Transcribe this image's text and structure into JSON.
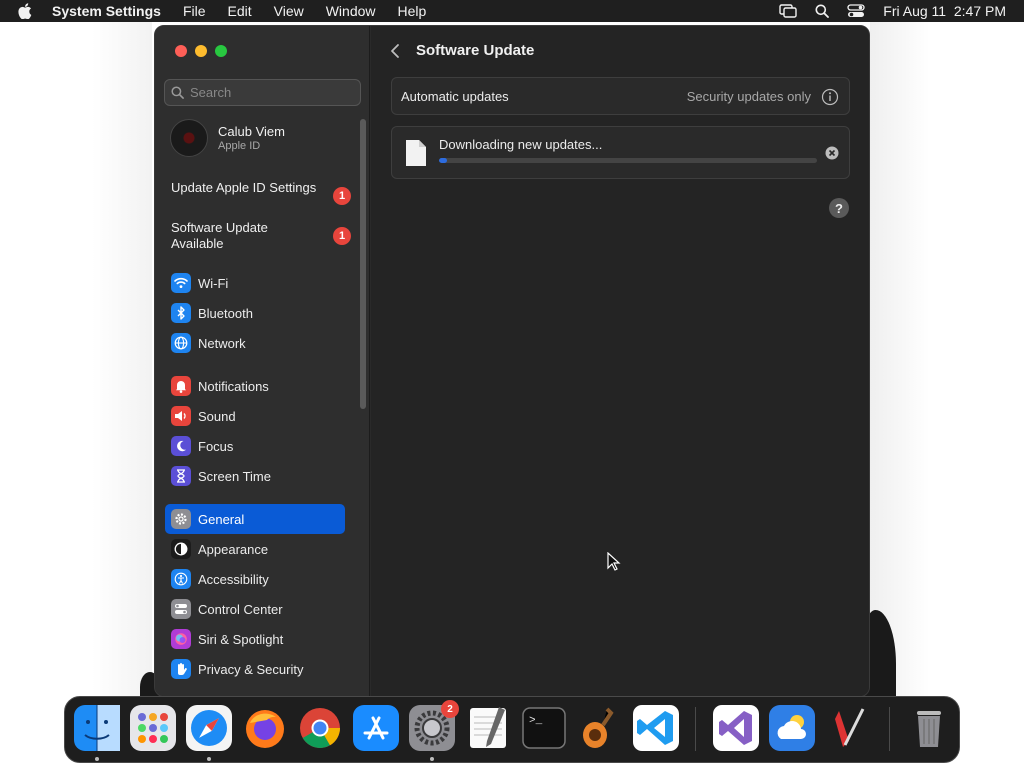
{
  "menubar": {
    "app_name": "System Settings",
    "menus": [
      "File",
      "Edit",
      "View",
      "Window",
      "Help"
    ],
    "datetime": "Fri Aug 11  2:47 PM"
  },
  "search": {
    "placeholder": "Search"
  },
  "account": {
    "name": "Calub Viem",
    "subtitle": "Apple ID"
  },
  "notices": [
    {
      "label": "Update Apple ID Settings",
      "badge": "1"
    },
    {
      "label": "Software Update Available",
      "badge": "1"
    }
  ],
  "nav_groups": [
    [
      {
        "label": "Wi-Fi",
        "icon": "wifi-icon",
        "color": "#1e84f0"
      },
      {
        "label": "Bluetooth",
        "icon": "bluetooth-icon",
        "color": "#1e84f0"
      },
      {
        "label": "Network",
        "icon": "globe-icon",
        "color": "#1e84f0"
      }
    ],
    [
      {
        "label": "Notifications",
        "icon": "bell-icon",
        "color": "#e8453c"
      },
      {
        "label": "Sound",
        "icon": "speaker-icon",
        "color": "#e8453c"
      },
      {
        "label": "Focus",
        "icon": "moon-icon",
        "color": "#5b4fd6"
      },
      {
        "label": "Screen Time",
        "icon": "hourglass-icon",
        "color": "#5b4fd6"
      }
    ],
    [
      {
        "label": "General",
        "icon": "gear-icon",
        "color": "#8e8e93",
        "active": true
      },
      {
        "label": "Appearance",
        "icon": "appearance-icon",
        "color": "#1c1c1c"
      },
      {
        "label": "Accessibility",
        "icon": "accessibility-icon",
        "color": "#1e84f0"
      },
      {
        "label": "Control Center",
        "icon": "control-center-icon",
        "color": "#8e8e93"
      },
      {
        "label": "Siri & Spotlight",
        "icon": "siri-icon",
        "color": "#b03cd6"
      },
      {
        "label": "Privacy & Security",
        "icon": "hand-icon",
        "color": "#1e84f0"
      }
    ]
  ],
  "content": {
    "title": "Software Update",
    "automatic_updates": {
      "label": "Automatic updates",
      "value": "Security updates only"
    },
    "download": {
      "text": "Downloading new updates...",
      "progress": 0.02
    },
    "help": "?"
  },
  "dock": {
    "apps": [
      {
        "name": "Finder",
        "running": true
      },
      {
        "name": "Launchpad"
      },
      {
        "name": "Safari",
        "running": true
      },
      {
        "name": "Firefox"
      },
      {
        "name": "Chrome"
      },
      {
        "name": "App Store"
      },
      {
        "name": "System Settings",
        "badge": "2",
        "running": true
      },
      {
        "name": "TextEdit"
      },
      {
        "name": "Terminal"
      },
      {
        "name": "GarageBand"
      },
      {
        "name": "Visual Studio Code"
      },
      {
        "name": "Visual Studio"
      },
      {
        "name": "Weather"
      },
      {
        "name": "Script Editor"
      },
      {
        "name": "Trash"
      }
    ]
  }
}
